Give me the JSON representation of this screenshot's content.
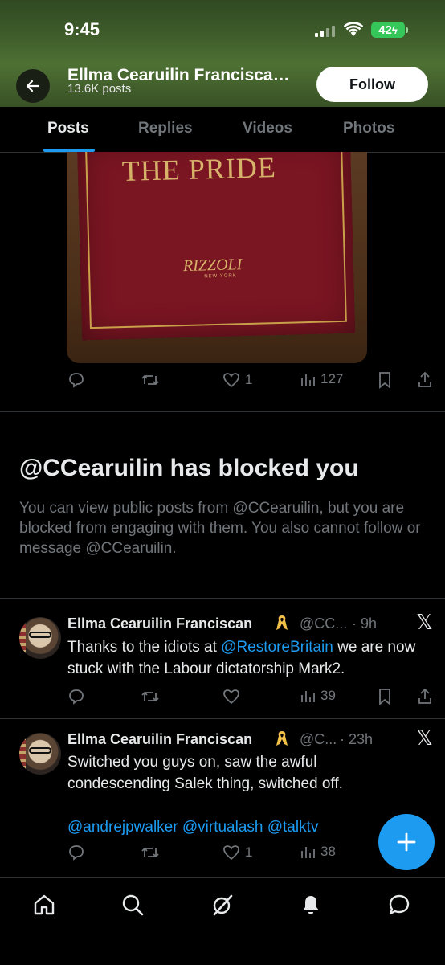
{
  "status_bar": {
    "time": "9:45",
    "battery": "42"
  },
  "profile": {
    "name": "Ellma Cearuilin Francisca…",
    "posts": "13.6K posts",
    "follow_label": "Follow"
  },
  "tabs": [
    {
      "label": "Posts",
      "active": true
    },
    {
      "label": "Replies"
    },
    {
      "label": "Videos"
    },
    {
      "label": "Photos"
    }
  ],
  "media": {
    "book_title": "THE PRIDE",
    "publisher": "RIZZOLI",
    "publisher_sub": "NEW YORK"
  },
  "top_post_actions": {
    "likes": "1",
    "views": "127"
  },
  "blocked": {
    "title": "@CCearuilin has blocked you",
    "message": "You can view public posts from @CCearuilin, but you are blocked from engaging with them. You also cannot follow or message @CCearuilin."
  },
  "posts": [
    {
      "author": "Ellma Cearuilin Franciscan",
      "handle": "@CC...",
      "time": "· 9h",
      "text_before": "Thanks to the idiots at ",
      "mention": "@RestoreBritain",
      "text_after": " we are now stuck with the Labour dictatorship Mark2.",
      "views": "39"
    },
    {
      "author": "Ellma Cearuilin Franciscan",
      "handle": "@C...",
      "time": "· 23h",
      "text": "Switched you guys on, saw the awful condescending Salek thing, switched off.",
      "mentions": "@andrejpwalker @virtualash @talktv",
      "likes": "1",
      "views": "38"
    }
  ],
  "colors": {
    "accent": "#1d9bf0",
    "text": "#e7e9ea",
    "muted": "#71767b",
    "background": "#000000"
  }
}
